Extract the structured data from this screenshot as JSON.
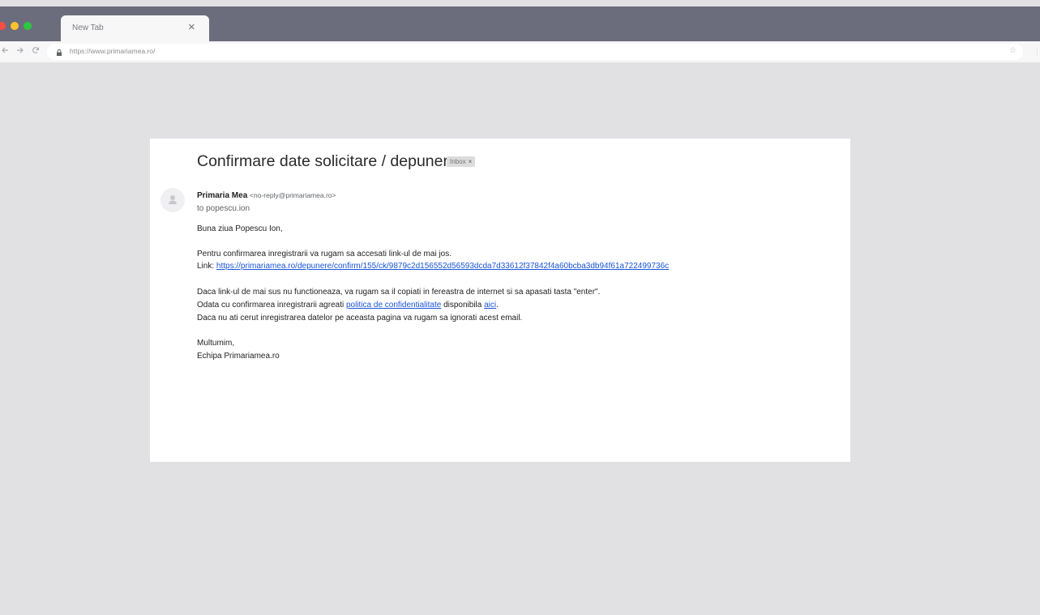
{
  "browser": {
    "tab_title": "New Tab",
    "tab_close": "×",
    "url": "https://www.primariamea.ro/",
    "icons": [
      "back-arrow-icon",
      "forward-arrow-icon",
      "reload-icon",
      "lock-icon",
      "star-icon"
    ],
    "colors": {
      "tab_bar": "#6b6d7c",
      "dot_red": "#ff4d43",
      "dot_yellow": "#ffc22e",
      "dot_green": "#2cc840"
    }
  },
  "email": {
    "subject": "Confirmare date solicitare / depunere",
    "badge": "Inbox",
    "badge_close": "×",
    "sender_name": "Primaria Mea",
    "sender_email": "<no-reply@primariamea.ro>",
    "to": "to popescu.ion",
    "greeting": "Buna ziua Popescu Ion,",
    "para1": "Pentru confirmarea inregistrarii va rugam sa accesati link-ul de mai jos.",
    "link_label": "Link:",
    "link_url": "https://primariamea.ro/depunere/confirm/155/ck/9879c2d156552d56593dcda7d33612f37842f4a60bcba3db94f61a722499736c",
    "para2": "Daca link-ul de mai sus nu functioneaza, va rugam sa il copiati in fereastra de internet si sa apasati tasta \"enter\".",
    "para3_prefix": "Odata cu confirmarea inregistrarii agreati",
    "para3_link": "politica de confidentialitate",
    "para3_mid": "disponibila",
    "para3_link2": "aici",
    "para3_suffix": ".",
    "para4": "Daca nu ati cerut inregistrarea datelor pe aceasta pagina va rugam sa ignorati acest email.",
    "closing": "Multumim,",
    "signature": "Echipa Primariamea.ro",
    "colors": {
      "link": "#1a55d6"
    }
  }
}
